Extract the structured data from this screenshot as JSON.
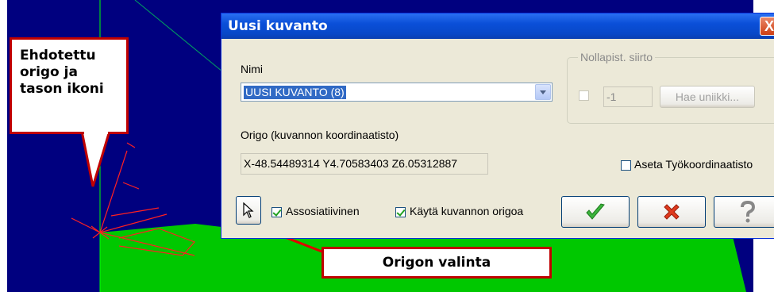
{
  "callouts": {
    "icon_note": [
      "Ehdotettu",
      "origo ja",
      "tason ikoni"
    ],
    "origin_selection": "Origon valinta"
  },
  "dialog": {
    "title": "Uusi kuvanto",
    "close_symbol": "X",
    "name_label": "Nimi",
    "name_value": "UUSI KUVANTO (8)",
    "origin_label": "Origo (kuvannon koordinaatisto)",
    "origin_value": "X-48.54489314 Y4.70583403 Z6.05312887",
    "zero_shift": {
      "title": "Nollapist. siirto",
      "checked": false,
      "value": "-1",
      "fetch_button": "Hae uniikki..."
    },
    "set_work_coords_label": "Aseta Työkoordinaatisto",
    "set_work_coords_checked": false,
    "associative_label": "Assosiatiivinen",
    "associative_checked": true,
    "use_view_origin_label": "Käytä kuvannon origoa",
    "use_view_origin_checked": true,
    "buttons": {
      "pick": "pointer-icon",
      "ok": "check-icon",
      "cancel": "x-icon",
      "help": "question-icon"
    }
  },
  "colors": {
    "background": "#00007f",
    "plane": "#00c800",
    "axis": "#00ff00",
    "annotation": "#ff0000",
    "callout_border": "#c00000",
    "titlebar": "#0a4fd8"
  }
}
